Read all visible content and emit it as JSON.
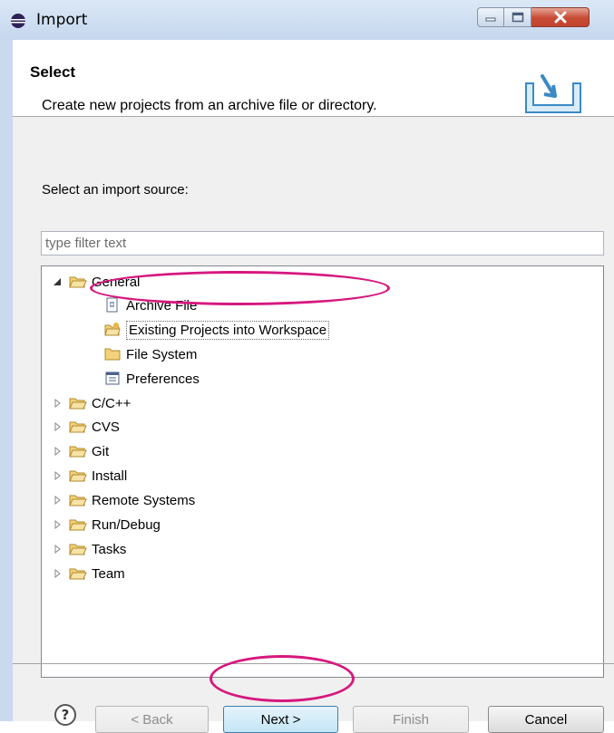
{
  "window": {
    "title": "Import"
  },
  "header": {
    "title": "Select",
    "description": "Create new projects from an archive file or directory."
  },
  "import_source": {
    "label": "Select an import source:",
    "filter_placeholder": "type filter text"
  },
  "tree": {
    "general": {
      "label": "General",
      "children": [
        "Archive File",
        "Existing Projects into Workspace",
        "File System",
        "Preferences"
      ]
    },
    "categories": [
      "C/C++",
      "CVS",
      "Git",
      "Install",
      "Remote Systems",
      "Run/Debug",
      "Tasks",
      "Team"
    ]
  },
  "buttons": {
    "help": "?",
    "back": "< Back",
    "next": "Next >",
    "finish": "Finish",
    "cancel": "Cancel"
  },
  "colors": {
    "highlight_ring": "#d6187e",
    "folder": "#f3d27a"
  }
}
